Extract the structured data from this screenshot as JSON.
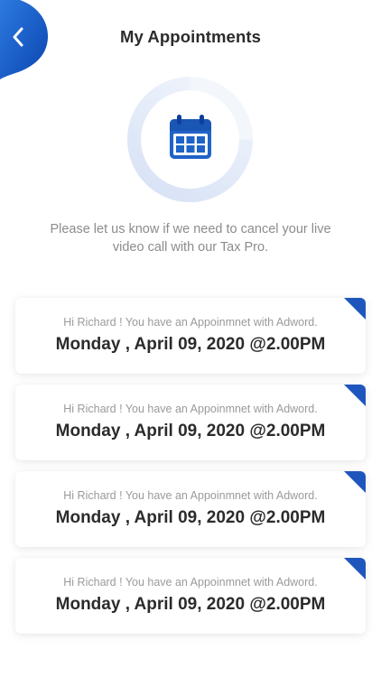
{
  "header": {
    "title": "My Appointments"
  },
  "intro": {
    "text": "Please let us know if we need to cancel your live video call with our Tax Pro."
  },
  "appointments": [
    {
      "message": "Hi Richard ! You have an Appoinmnet with Adword.",
      "date": "Monday , April 09, 2020 @2.00PM"
    },
    {
      "message": "Hi Richard ! You have an Appoinmnet with Adword.",
      "date": "Monday , April 09, 2020 @2.00PM"
    },
    {
      "message": "Hi Richard ! You have an Appoinmnet with Adword.",
      "date": "Monday , April 09, 2020 @2.00PM"
    },
    {
      "message": "Hi Richard ! You have an Appoinmnet with Adword.",
      "date": "Monday , April 09, 2020 @2.00PM"
    }
  ],
  "icons": {
    "back": "chevron-left-icon",
    "calendar": "calendar-icon"
  },
  "colors": {
    "accent": "#1f63c8",
    "accent_dark": "#0d3f9c",
    "ring_light": "#e3ebf8",
    "text_dark": "#2b2b2b",
    "text_muted": "#8c8c8c"
  }
}
